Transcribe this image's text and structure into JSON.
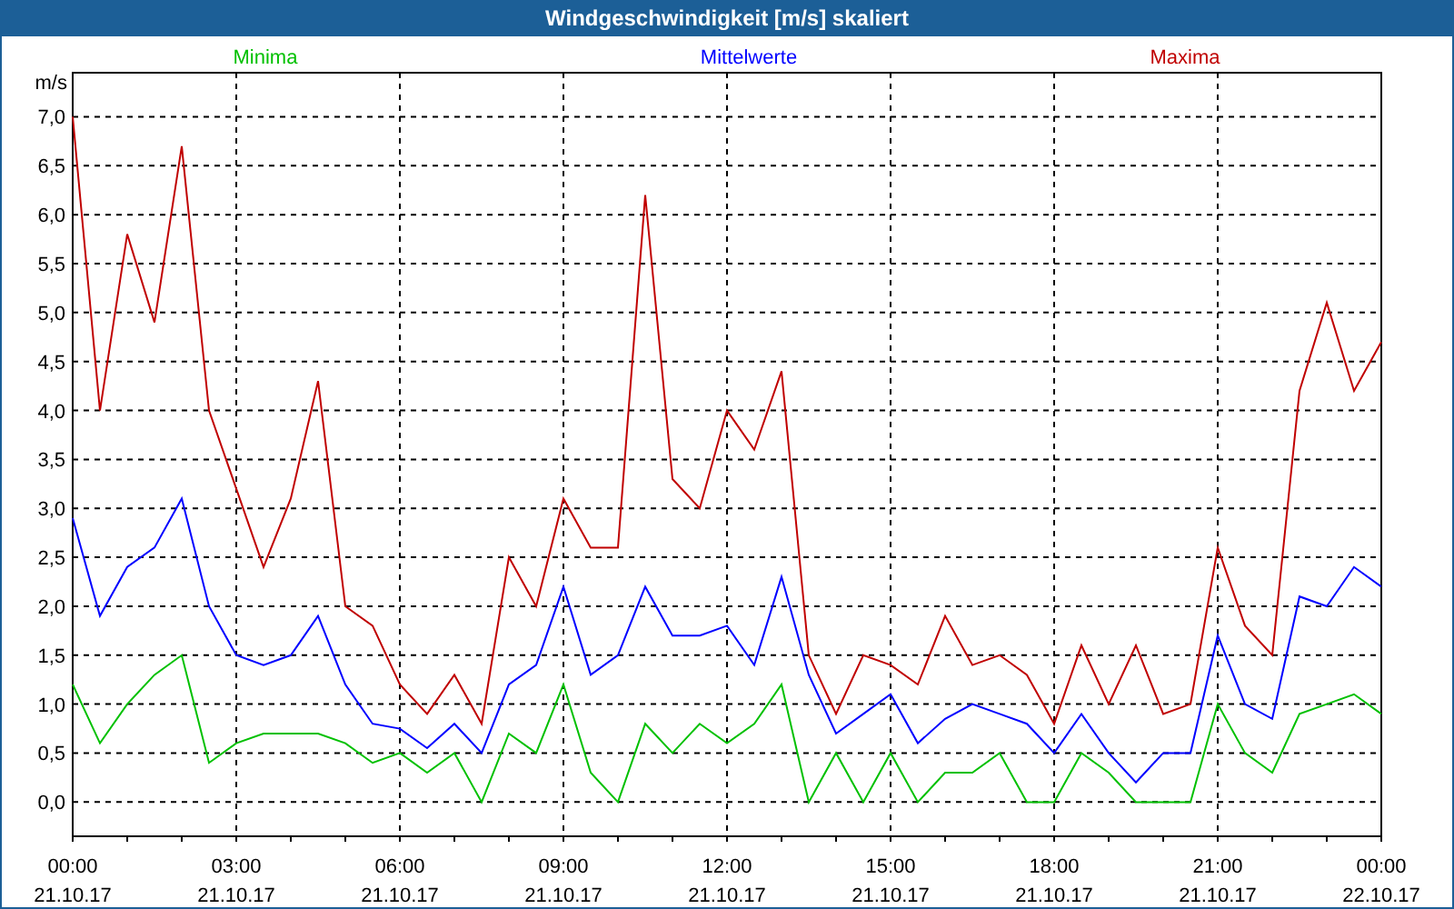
{
  "window": {
    "title": "Windgeschwindigkeit [m/s] skaliert"
  },
  "chart": {
    "chart_data": {
      "type": "line",
      "ylabel": "m/s",
      "xlim": [
        0,
        24
      ],
      "ylim": [
        -0.35,
        7.45
      ],
      "x": [
        0,
        0.5,
        1,
        1.5,
        2,
        2.5,
        3,
        3.5,
        4,
        4.5,
        5,
        5.5,
        6,
        6.5,
        7,
        7.5,
        8,
        8.5,
        9,
        9.5,
        10,
        10.5,
        11,
        11.5,
        12,
        12.5,
        13,
        13.5,
        14,
        14.5,
        15,
        15.5,
        16,
        16.5,
        17,
        17.5,
        18,
        18.5,
        19,
        19.5,
        20,
        20.5,
        21,
        21.5,
        22,
        22.5,
        23,
        23.5,
        24
      ],
      "series": [
        {
          "name": "Minima",
          "color": "#00c000",
          "values": [
            1.2,
            0.6,
            1.0,
            1.3,
            1.5,
            0.4,
            0.6,
            0.7,
            0.7,
            0.7,
            0.6,
            0.4,
            0.5,
            0.3,
            0.5,
            0.0,
            0.7,
            0.5,
            1.2,
            0.3,
            0.0,
            0.8,
            0.5,
            0.8,
            0.6,
            0.8,
            1.2,
            0.0,
            0.5,
            0.0,
            0.5,
            0.0,
            0.3,
            0.3,
            0.5,
            0.0,
            0.0,
            0.5,
            0.3,
            0.0,
            0.0,
            0.0,
            1.0,
            0.5,
            0.3,
            0.9,
            1.0,
            1.1,
            0.9
          ]
        },
        {
          "name": "Mittelwerte",
          "color": "#0000ff",
          "values": [
            2.9,
            1.9,
            2.4,
            2.6,
            3.1,
            2.0,
            1.5,
            1.4,
            1.5,
            1.9,
            1.2,
            0.8,
            0.75,
            0.55,
            0.8,
            0.5,
            1.2,
            1.4,
            2.2,
            1.3,
            1.5,
            2.2,
            1.7,
            1.7,
            1.8,
            1.4,
            2.3,
            1.3,
            0.7,
            0.9,
            1.1,
            0.6,
            0.85,
            1.0,
            0.9,
            0.8,
            0.5,
            0.9,
            0.5,
            0.2,
            0.5,
            0.5,
            1.7,
            1.0,
            0.85,
            2.1,
            2.0,
            2.4,
            2.2
          ]
        },
        {
          "name": "Maxima",
          "color": "#c00000",
          "values": [
            7.0,
            4.0,
            5.8,
            4.9,
            6.7,
            4.0,
            3.2,
            2.4,
            3.1,
            4.3,
            2.0,
            1.8,
            1.2,
            0.9,
            1.3,
            0.8,
            2.5,
            2.0,
            3.1,
            2.6,
            2.6,
            6.2,
            3.3,
            3.0,
            4.0,
            3.6,
            4.4,
            1.5,
            0.9,
            1.5,
            1.4,
            1.2,
            1.9,
            1.4,
            1.5,
            1.3,
            0.8,
            1.6,
            1.0,
            1.6,
            0.9,
            1.0,
            2.6,
            1.8,
            1.5,
            4.2,
            5.1,
            4.2,
            4.7
          ]
        }
      ],
      "yticks": [
        {
          "value": 0,
          "label": "0,0"
        },
        {
          "value": 0.5,
          "label": "0,5"
        },
        {
          "value": 1,
          "label": "1,0"
        },
        {
          "value": 1.5,
          "label": "1,5"
        },
        {
          "value": 2,
          "label": "2,0"
        },
        {
          "value": 2.5,
          "label": "2,5"
        },
        {
          "value": 3,
          "label": "3,0"
        },
        {
          "value": 3.5,
          "label": "3,5"
        },
        {
          "value": 4,
          "label": "4,0"
        },
        {
          "value": 4.5,
          "label": "4,5"
        },
        {
          "value": 5,
          "label": "5,0"
        },
        {
          "value": 5.5,
          "label": "5,5"
        },
        {
          "value": 6,
          "label": "6,0"
        },
        {
          "value": 6.5,
          "label": "6,5"
        },
        {
          "value": 7,
          "label": "7,0"
        }
      ],
      "xticks": [
        {
          "value": 0,
          "label": "00:00"
        },
        {
          "value": 3,
          "label": "03:00"
        },
        {
          "value": 6,
          "label": "06:00"
        },
        {
          "value": 9,
          "label": "09:00"
        },
        {
          "value": 12,
          "label": "12:00"
        },
        {
          "value": 15,
          "label": "15:00"
        },
        {
          "value": 18,
          "label": "18:00"
        },
        {
          "value": 21,
          "label": "21:00"
        },
        {
          "value": 24,
          "label": "00:00"
        }
      ],
      "grid": true
    },
    "x_axis_dates": [
      "21.10.17",
      "21.10.17",
      "21.10.17",
      "21.10.17",
      "21.10.17",
      "21.10.17",
      "21.10.17",
      "21.10.17",
      "22.10.17"
    ]
  }
}
